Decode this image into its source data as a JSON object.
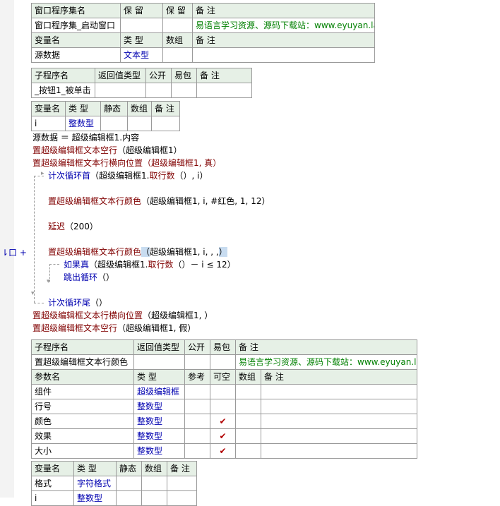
{
  "program_set": {
    "headers": [
      "窗口程序集名",
      "保 留",
      "保 留",
      "备 注"
    ],
    "name": "窗口程序集_启动窗口",
    "note": "易语言学习资源、源码下载站：www.eyuyan.la",
    "var_headers": [
      "变量名",
      "类 型",
      "数组",
      "备 注"
    ],
    "var": {
      "name": "源数据",
      "type": "文本型"
    }
  },
  "sub1": {
    "headers": [
      "子程序名",
      "返回值类型",
      "公开",
      "易包",
      "备 注"
    ],
    "name": "_按钮1_被单击",
    "var_headers": [
      "变量名",
      "类 型",
      "静态",
      "数组",
      "备 注"
    ],
    "var": {
      "name": "i",
      "type": "整数型"
    }
  },
  "code": {
    "l1": "源数据 ＝ 超级编辑框1.内容",
    "l2_fn": "置超级编辑框文本空行",
    "l2_args": "（超级编辑框1）",
    "l3_fn": "置超级编辑框文本行横向位置",
    "l3_args": "（超级编辑框1, 真）",
    "l4_kw": "计次循环首",
    "l4_a": "（超级编辑框1.",
    "l4_b": "取行数",
    "l4_c": "（）, i）",
    "l5_fn": "置超级编辑框文本行颜色",
    "l5_args": "（超级编辑框1, i, #红色, 1, 12）",
    "l6_fn": "延迟",
    "l6_args": "（200）",
    "l7_fn": "置超级编辑框文本行颜色",
    "l7_open": "（",
    "l7_args": "超级编辑框1, i, , ,",
    "l7_close": "）",
    "l8_kw": "如果真",
    "l8_a": "（超级编辑框1.",
    "l8_b": "取行数",
    "l8_c": "（）－ i ≤ 12）",
    "l9_kw": "跳出循环",
    "l9_args": "（）",
    "l10_kw": "计次循环尾",
    "l10_args": "（）",
    "l11_fn": "置超级编辑框文本行横向位置",
    "l11_args": "（超级编辑框1, ）",
    "l12_fn": "置超级编辑框文本空行",
    "l12_args": "（超级编辑框1, 假）"
  },
  "sub2": {
    "headers": [
      "子程序名",
      "返回值类型",
      "公开",
      "易包",
      "备 注"
    ],
    "name": "置超级编辑框文本行颜色",
    "note": "易语言学习资源、源码下载站：www.eyuyan.la",
    "param_headers": [
      "参数名",
      "类 型",
      "参考",
      "可空",
      "数组",
      "备 注"
    ],
    "params": [
      {
        "name": "组件",
        "type": "超级编辑框",
        "nullable": ""
      },
      {
        "name": "行号",
        "type": "整数型",
        "nullable": ""
      },
      {
        "name": "颜色",
        "type": "整数型",
        "nullable": "✔"
      },
      {
        "name": "效果",
        "type": "整数型",
        "nullable": "✔"
      },
      {
        "name": "大小",
        "type": "整数型",
        "nullable": "✔"
      }
    ],
    "var_headers": [
      "变量名",
      "类 型",
      "静态",
      "数组",
      "备 注"
    ],
    "vars": [
      {
        "name": "格式",
        "type": "字符格式"
      },
      {
        "name": "i",
        "type": "整数型"
      }
    ]
  },
  "gutter_marker": "⇂口 +"
}
